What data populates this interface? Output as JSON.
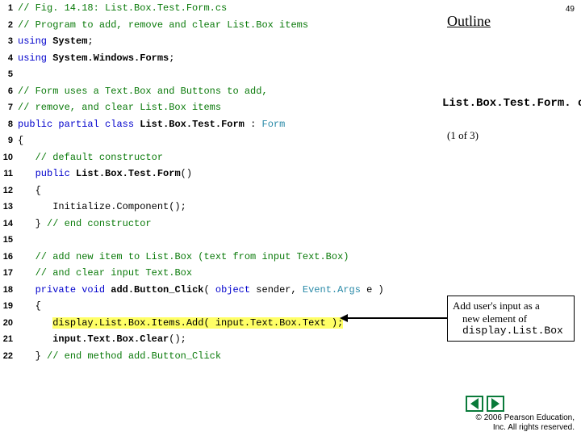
{
  "page_number": "49",
  "outline_label": "Outline",
  "filename": "List.Box.Test.Form. cs",
  "part": "(1 of 3)",
  "callout": {
    "line1": "Add user's input as a",
    "line2": "new element of",
    "code": "display.List.Box"
  },
  "copyright": {
    "line1": "© 2006 Pearson Education,",
    "line2": "Inc.  All rights reserved."
  },
  "nav": {
    "prev": "prev",
    "next": "next"
  },
  "code": [
    {
      "n": "1",
      "tokens": [
        [
          "comment",
          "// Fig. 14.18: List.Box.Test.Form.cs"
        ]
      ]
    },
    {
      "n": "2",
      "tokens": [
        [
          "comment",
          "// Program to add, remove and clear List.Box items"
        ]
      ]
    },
    {
      "n": "3",
      "tokens": [
        [
          "keyword",
          "using"
        ],
        [
          "plain",
          " "
        ],
        [
          "ident",
          "System"
        ],
        [
          "plain",
          ";"
        ]
      ]
    },
    {
      "n": "4",
      "tokens": [
        [
          "keyword",
          "using"
        ],
        [
          "plain",
          " "
        ],
        [
          "ident",
          "System.Windows.Forms"
        ],
        [
          "plain",
          ";"
        ]
      ]
    },
    {
      "n": "5",
      "tokens": []
    },
    {
      "n": "6",
      "tokens": [
        [
          "comment",
          "// Form uses a Text.Box and Buttons to add,"
        ]
      ]
    },
    {
      "n": "7",
      "tokens": [
        [
          "comment",
          "// remove, and clear List.Box items"
        ]
      ]
    },
    {
      "n": "8",
      "tokens": [
        [
          "keyword",
          "public"
        ],
        [
          "plain",
          " "
        ],
        [
          "keyword",
          "partial"
        ],
        [
          "plain",
          " "
        ],
        [
          "keyword",
          "class"
        ],
        [
          "plain",
          " "
        ],
        [
          "ident",
          "List.Box.Test.Form"
        ],
        [
          "plain",
          " : "
        ],
        [
          "type",
          "Form"
        ]
      ]
    },
    {
      "n": "9",
      "tokens": [
        [
          "plain",
          "{"
        ]
      ]
    },
    {
      "n": "10",
      "tokens": [
        [
          "plain",
          "   "
        ],
        [
          "comment",
          "// default constructor"
        ]
      ]
    },
    {
      "n": "11",
      "tokens": [
        [
          "plain",
          "   "
        ],
        [
          "keyword",
          "public"
        ],
        [
          "plain",
          " "
        ],
        [
          "ident",
          "List.Box.Test.Form"
        ],
        [
          "plain",
          "()"
        ]
      ]
    },
    {
      "n": "12",
      "tokens": [
        [
          "plain",
          "   {"
        ]
      ]
    },
    {
      "n": "13",
      "tokens": [
        [
          "plain",
          "      Initialize.Component();"
        ]
      ]
    },
    {
      "n": "14",
      "tokens": [
        [
          "plain",
          "   } "
        ],
        [
          "comment",
          "// end constructor"
        ]
      ]
    },
    {
      "n": "15",
      "tokens": []
    },
    {
      "n": "16",
      "tokens": [
        [
          "plain",
          "   "
        ],
        [
          "comment",
          "// add new item to List.Box (text from input Text.Box)"
        ]
      ]
    },
    {
      "n": "17",
      "tokens": [
        [
          "plain",
          "   "
        ],
        [
          "comment",
          "// and clear input Text.Box"
        ]
      ]
    },
    {
      "n": "18",
      "tokens": [
        [
          "plain",
          "   "
        ],
        [
          "keyword",
          "private"
        ],
        [
          "plain",
          " "
        ],
        [
          "keyword",
          "void"
        ],
        [
          "plain",
          " "
        ],
        [
          "ident",
          "add.Button_Click"
        ],
        [
          "plain",
          "( "
        ],
        [
          "keyword",
          "object"
        ],
        [
          "plain",
          " sender, "
        ],
        [
          "type",
          "Event.Args"
        ],
        [
          "plain",
          " e ) "
        ]
      ]
    },
    {
      "n": "19",
      "tokens": [
        [
          "plain",
          "   {"
        ]
      ]
    },
    {
      "n": "20",
      "tokens": [
        [
          "plain",
          "      "
        ],
        [
          "hl",
          "display.List.Box.Items.Add( input.Text.Box.Text );"
        ]
      ]
    },
    {
      "n": "21",
      "tokens": [
        [
          "plain",
          "      "
        ],
        [
          "ident",
          "input.Text.Box.Clear"
        ],
        [
          "plain",
          "();"
        ]
      ]
    },
    {
      "n": "22",
      "tokens": [
        [
          "plain",
          "   } "
        ],
        [
          "comment",
          "// end method add.Button_Click"
        ]
      ]
    }
  ]
}
